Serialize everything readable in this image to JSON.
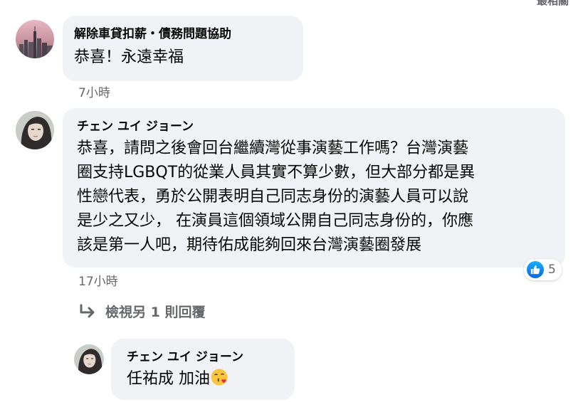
{
  "top_partial": "最相關",
  "comments": [
    {
      "author": "解除車貸扣薪・債務問題協助",
      "text": "恭喜！永遠幸福",
      "time": "7小時"
    },
    {
      "author": "チェン ユイ ジョーン",
      "text": "恭喜，請問之後會回台繼續灣從事演藝工作嗎？台灣演藝圈支持LGBQT的從業人員其實不算少數，但大部分都是異性戀代表，勇於公開表明自己同志身份的演藝人員可以說是少之又少， 在演員這個領域公開自己同志身份的，你應該是第一人吧，期待佑成能夠回來台灣演藝圈發展",
      "lines": [
        "恭喜，請問之後會回台繼續灣從事演藝工作嗎？台灣演藝",
        "圈支持LGBQT的從業人員其實不算少數，但大部分都是異",
        "性戀代表，勇於公開表明自己同志身份的演藝人員可以說",
        "是少之又少， 在演員這個領域公開自己同志身份的，你應",
        "該是第一人吧，期待佑成能夠回來台灣演藝圈發展"
      ],
      "time": "17小時",
      "reaction": {
        "icon": "like-icon",
        "count": "5",
        "color": "#1877f2"
      },
      "view_replies": "檢視另 1 則回覆"
    }
  ],
  "reply": {
    "author": "チェン ユイ ジョーン",
    "text": "任祐成 加油",
    "emoji": "face-blowing-kiss-emoji"
  },
  "colors": {
    "bubble": "#f0f2f5",
    "secondary_text": "#65676b",
    "primary_text": "#050505"
  }
}
